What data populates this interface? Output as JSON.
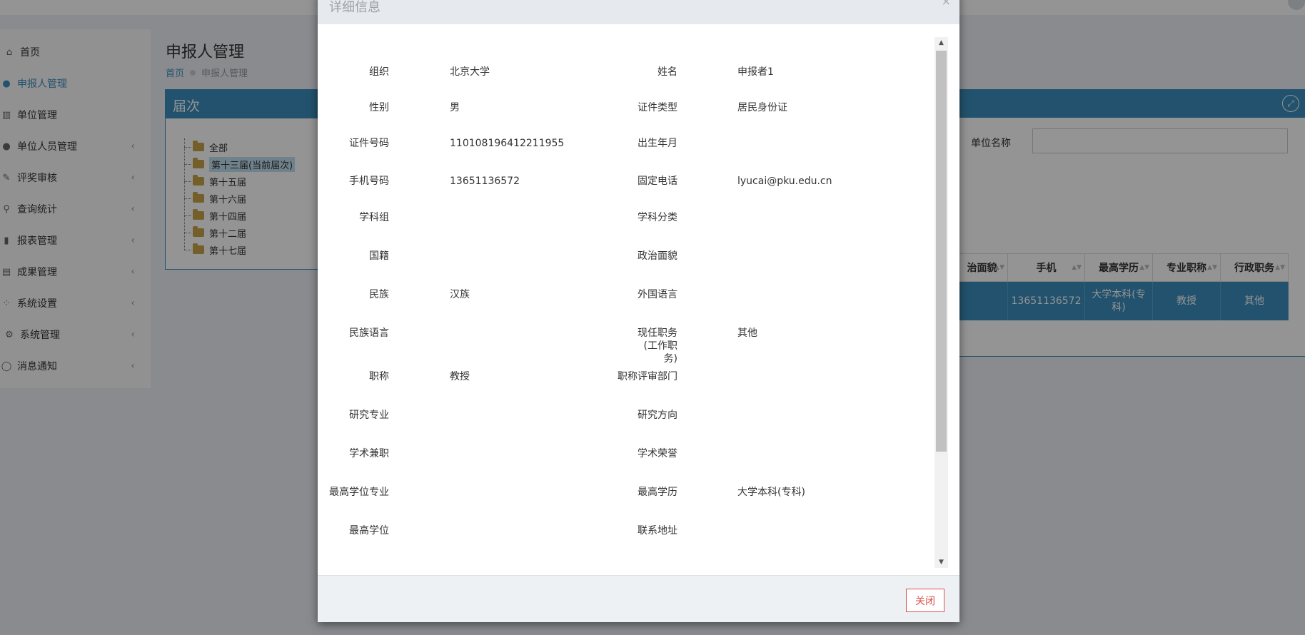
{
  "sidebar": {
    "items": [
      {
        "label": "首页",
        "icon": "home-icon",
        "chevron": false,
        "active": false
      },
      {
        "label": "申报人管理",
        "icon": "user-icon",
        "chevron": false,
        "active": true
      },
      {
        "label": "单位管理",
        "icon": "bank-icon",
        "chevron": false,
        "active": false
      },
      {
        "label": "单位人员管理",
        "icon": "users-icon",
        "chevron": true,
        "active": false
      },
      {
        "label": "评奖审核",
        "icon": "edit-icon",
        "chevron": true,
        "active": false
      },
      {
        "label": "查询统计",
        "icon": "search-icon",
        "chevron": true,
        "active": false
      },
      {
        "label": "报表管理",
        "icon": "bar-chart-icon",
        "chevron": true,
        "active": false
      },
      {
        "label": "成果管理",
        "icon": "document-icon",
        "chevron": true,
        "active": false
      },
      {
        "label": "系统设置",
        "icon": "sitemap-icon",
        "chevron": true,
        "active": false
      },
      {
        "label": "系统管理",
        "icon": "gear-icon",
        "chevron": true,
        "active": false
      },
      {
        "label": "消息通知",
        "icon": "chat-icon",
        "chevron": true,
        "active": false
      }
    ]
  },
  "page": {
    "title": "申报人管理",
    "breadcrumb_home": "首页",
    "breadcrumb_current": "申报人管理"
  },
  "tree_panel": {
    "title": "届次",
    "items": [
      "全部",
      "第十三届(当前届次)",
      "第十五届",
      "第十六届",
      "第十四届",
      "第十二届",
      "第十七届"
    ],
    "selected_index": 1
  },
  "filter": {
    "unit_label": "单位名称",
    "unit_value": ""
  },
  "table": {
    "headers": [
      "治面貌",
      "手机",
      "最高学历",
      "专业职称",
      "行政职务"
    ],
    "row": [
      "",
      "13651136572",
      "大学本科(专科)",
      "教授",
      "其他"
    ]
  },
  "modal": {
    "title": "详细信息",
    "close_label": "关闭",
    "fields": [
      {
        "left_label": "组织",
        "left_value": "北京大学",
        "right_label": "姓名",
        "right_value": "申报者1"
      },
      {
        "left_label": "性别",
        "left_value": "男",
        "right_label": "证件类型",
        "right_value": "居民身份证"
      },
      {
        "left_label": "证件号码",
        "left_value": "110108196412211955",
        "right_label": "出生年月",
        "right_value": ""
      },
      {
        "left_label": "手机号码",
        "left_value": "13651136572",
        "right_label": "固定电话",
        "right_value": "lyucai@pku.edu.cn"
      },
      {
        "left_label": "学科组",
        "left_value": "",
        "right_label": "学科分类",
        "right_value": ""
      },
      {
        "left_label": "国籍",
        "left_value": "",
        "right_label": "政治面貌",
        "right_value": ""
      },
      {
        "left_label": "民族",
        "left_value": "汉族",
        "right_label": "外国语言",
        "right_value": ""
      },
      {
        "left_label": "民族语言",
        "left_value": "",
        "right_label": "现任职务(工作职务)",
        "right_value": "其他"
      },
      {
        "left_label": "职称",
        "left_value": "教授",
        "right_label": "职称评审部门",
        "right_value": ""
      },
      {
        "left_label": "研究专业",
        "left_value": "",
        "right_label": "研究方向",
        "right_value": ""
      },
      {
        "left_label": "学术兼职",
        "left_value": "",
        "right_label": "学术荣誉",
        "right_value": ""
      },
      {
        "left_label": "最高学位专业",
        "left_value": "",
        "right_label": "最高学历",
        "right_value": "大学本科(专科)"
      },
      {
        "left_label": "最高学位",
        "left_value": "",
        "right_label": "联系地址",
        "right_value": ""
      }
    ]
  }
}
